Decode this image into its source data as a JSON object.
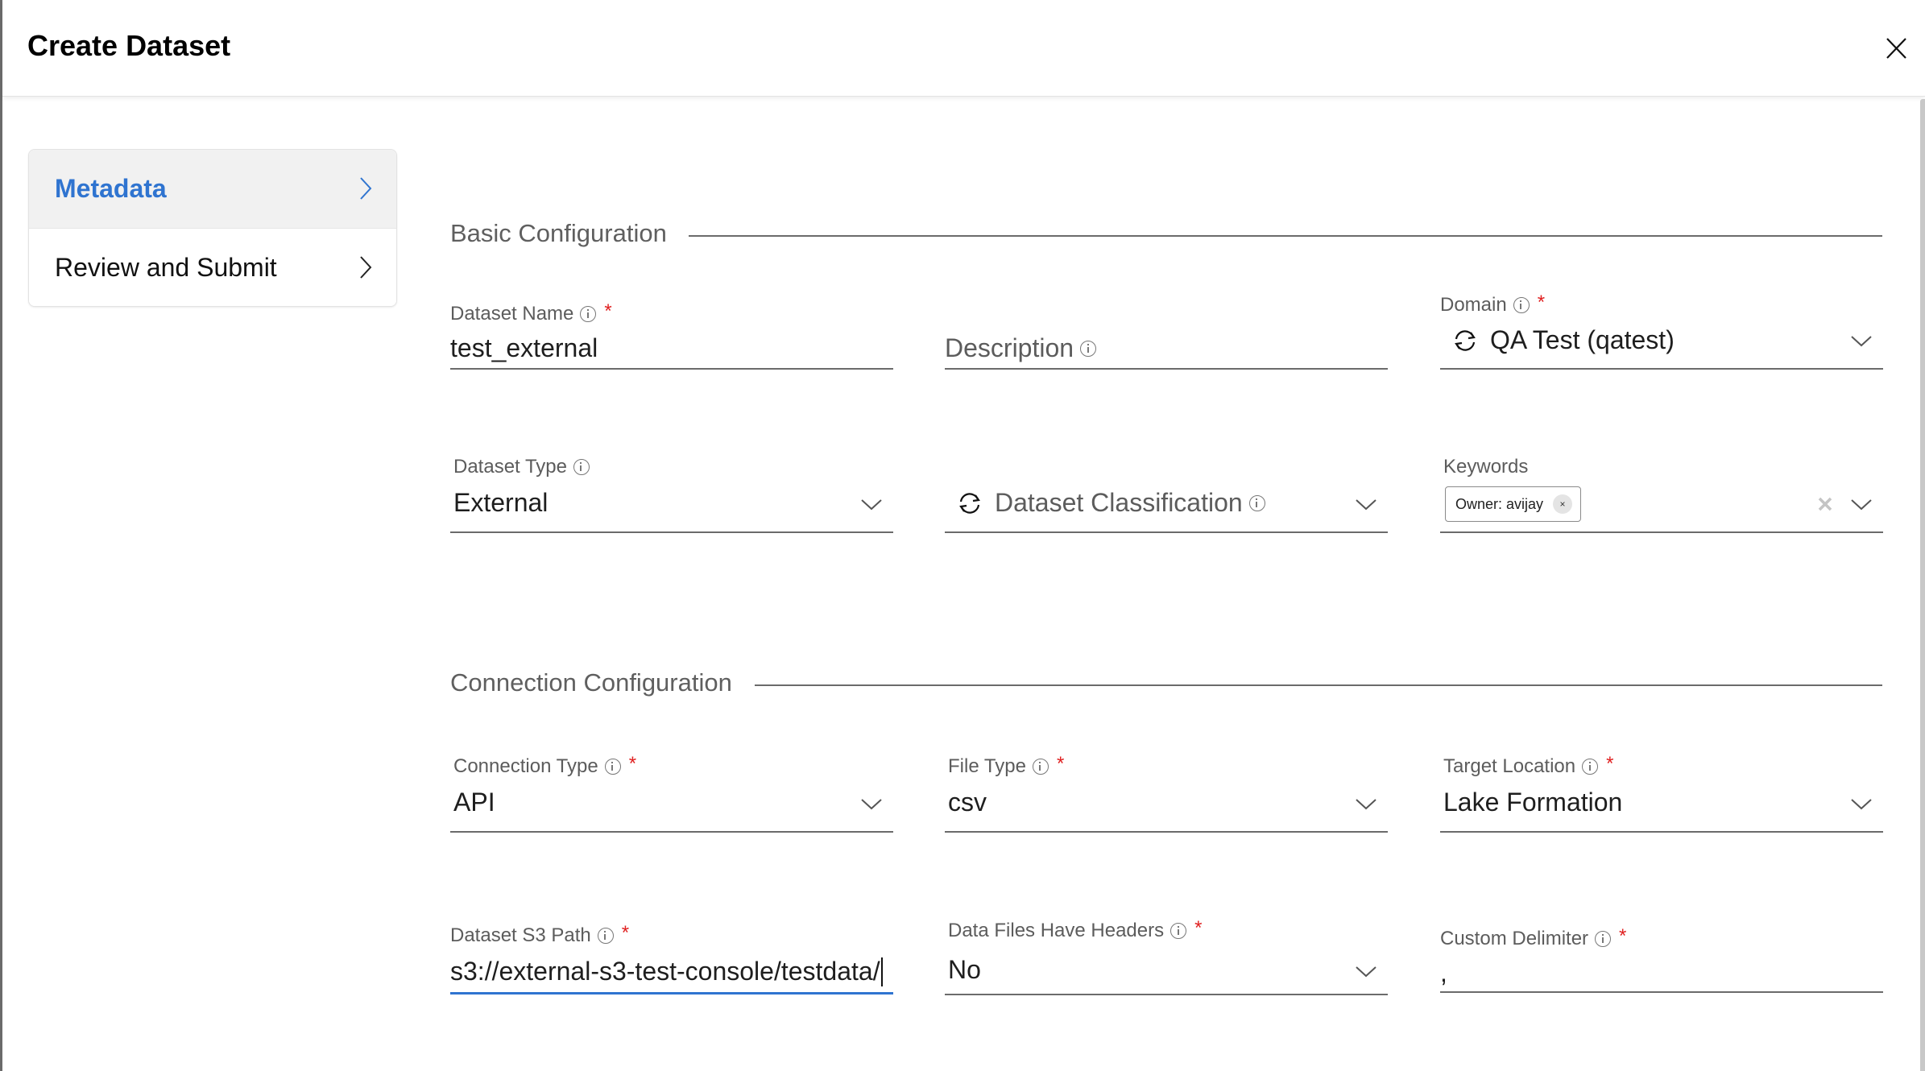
{
  "dialog": {
    "title": "Create Dataset",
    "close_icon": "close-icon"
  },
  "steps": [
    {
      "label": "Metadata",
      "active": true,
      "icon": "chevron-right-icon"
    },
    {
      "label": "Review and Submit",
      "active": false,
      "icon": "chevron-right-icon"
    }
  ],
  "sections": {
    "basic": "Basic Configuration",
    "connection": "Connection Configuration"
  },
  "fields": {
    "dataset_name": {
      "label": "Dataset Name",
      "required": "*",
      "value": "test_external"
    },
    "description": {
      "label": "Description",
      "required": "",
      "value": "",
      "placeholder": "Description"
    },
    "domain": {
      "label": "Domain",
      "required": "*",
      "value": "QA Test (qatest)",
      "icon": "sync-icon"
    },
    "dataset_type": {
      "label": "Dataset Type",
      "required": "",
      "value": "External"
    },
    "dataset_classification": {
      "label": "",
      "placeholder": "Dataset Classification",
      "value": "",
      "icon": "sync-icon"
    },
    "keywords": {
      "label": "Keywords",
      "chips": [
        "Owner: avijay"
      ],
      "chip_remove": "×"
    },
    "connection_type": {
      "label": "Connection Type",
      "required": "*",
      "value": "API"
    },
    "file_type": {
      "label": "File Type",
      "required": "*",
      "value": "csv"
    },
    "target_location": {
      "label": "Target Location",
      "required": "*",
      "value": "Lake Formation"
    },
    "dataset_s3_path": {
      "label": "Dataset S3 Path",
      "required": "*",
      "value": "s3://external-s3-test-console/testdata/"
    },
    "data_files_have_headers": {
      "label": "Data Files Have Headers",
      "required": "*",
      "value": "No"
    },
    "custom_delimiter": {
      "label": "Custom Delimiter",
      "required": "*",
      "value": ","
    }
  },
  "colors": {
    "accent": "#2f74d0",
    "required": "#e02020",
    "active_step_bg": "#f1f1f1"
  }
}
